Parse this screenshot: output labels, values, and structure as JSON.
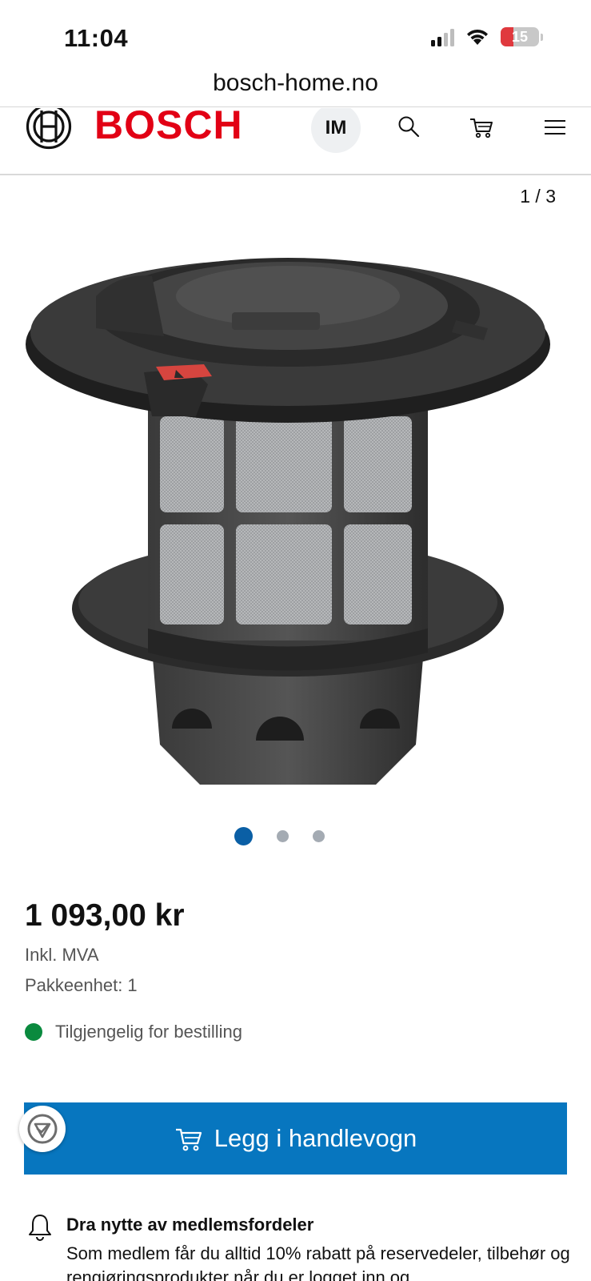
{
  "status_bar": {
    "time": "11:04",
    "battery": "15"
  },
  "browser": {
    "url": "bosch-home.no"
  },
  "header": {
    "brand": "BOSCH",
    "avatar_initials": "IM"
  },
  "gallery": {
    "counter": "1 / 3",
    "total_images": 3,
    "active_index": 0
  },
  "product": {
    "price": "1 093,00 kr",
    "vat_note": "Inkl. MVA",
    "pack_unit": "Pakkeenhet: 1",
    "availability": "Tilgjengelig for bestilling",
    "add_to_cart_label": "Legg i handlevogn"
  },
  "member_benefits": {
    "title": "Dra nytte av medlemsfordeler",
    "text": "Som medlem får du alltid 10% rabatt på reservedeler, tilbehør og rengjøringsprodukter når du er logget inn og"
  },
  "colors": {
    "brand_red": "#e20015",
    "primary_blue": "#0776bf",
    "available_green": "#0a8a3e",
    "active_dot": "#0a5fa5"
  }
}
